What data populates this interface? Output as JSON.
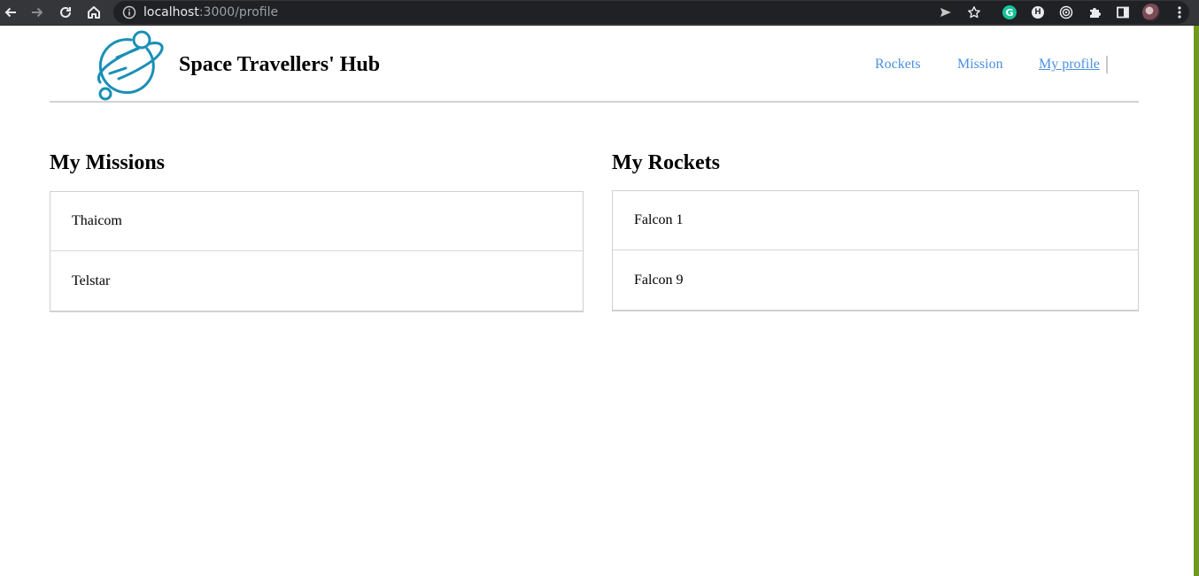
{
  "browser": {
    "url_host": "localhost",
    "url_path": ":3000/profile",
    "icons": [
      "back-icon",
      "forward-icon",
      "reload-icon",
      "home-icon",
      "site-info-icon",
      "send-icon",
      "star-icon",
      "grammarly-icon",
      "extension-h-icon",
      "target-icon",
      "puzzle-icon",
      "side-panel-icon",
      "profile-avatar",
      "menu-dots-icon"
    ],
    "grammarly_letter": "G",
    "ext_letter": "H"
  },
  "header": {
    "brand": "Space Travellers' Hub",
    "nav": [
      {
        "label": "Rockets",
        "active": false
      },
      {
        "label": "Mission",
        "active": false
      },
      {
        "label": "My profile",
        "active": true
      }
    ]
  },
  "missions": {
    "title": "My Missions",
    "items": [
      "Thaicom",
      "Telstar"
    ]
  },
  "rockets": {
    "title": "My Rockets",
    "items": [
      "Falcon 1",
      "Falcon 9"
    ]
  },
  "colors": {
    "accent": "#4a90e2",
    "logo": "#1a8fb5",
    "chrome": "#35363a",
    "scrollbar_edge": "#6f9a1f"
  }
}
